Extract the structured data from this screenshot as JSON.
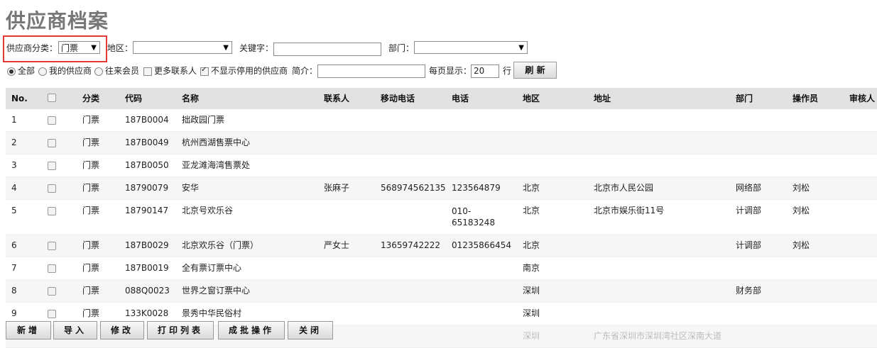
{
  "page": {
    "title": "供应商档案"
  },
  "filters": {
    "category_label": "供应商分类：",
    "category_value": "门票",
    "region_label": "地区：",
    "region_value": "",
    "keyword_label": "关键字：",
    "keyword_value": "",
    "dept_label": "部门：",
    "dept_value": ""
  },
  "options": {
    "all": "全部",
    "mine": "我的供应商",
    "past": "往来会员",
    "more_contacts": "更多联系人",
    "hide_disabled": "不显示停用的供应商",
    "intro_label": "简介：",
    "intro_value": "",
    "per_page_label": "每页显示：",
    "per_page_value": "20",
    "row_unit": "行",
    "refresh": "刷 新"
  },
  "table": {
    "headers": {
      "no": "No.",
      "category": "分类",
      "code": "代码",
      "name": "名称",
      "contact": "联系人",
      "mobile": "移动电话",
      "phone": "电话",
      "region": "地区",
      "address": "地址",
      "dept": "部门",
      "operator": "操作员",
      "reviewer": "审核人"
    },
    "rows": [
      {
        "no": "1",
        "category": "门票",
        "code": "187B0004",
        "name": "拙政园门票",
        "contact": "",
        "mobile": "",
        "phone": "",
        "region": "",
        "address": "",
        "dept": "",
        "operator": ""
      },
      {
        "no": "2",
        "category": "门票",
        "code": "187B0049",
        "name": "杭州西湖售票中心",
        "contact": "",
        "mobile": "",
        "phone": "",
        "region": "",
        "address": "",
        "dept": "",
        "operator": ""
      },
      {
        "no": "3",
        "category": "门票",
        "code": "187B0050",
        "name": "亚龙滩海湾售票处",
        "contact": "",
        "mobile": "",
        "phone": "",
        "region": "",
        "address": "",
        "dept": "",
        "operator": ""
      },
      {
        "no": "4",
        "category": "门票",
        "code": "18790079",
        "name": "安华",
        "contact": "张麻子",
        "mobile": "568974562135",
        "phone": "123564879",
        "region": "北京",
        "address": "北京市人民公园",
        "dept": "网络部",
        "operator": "刘松"
      },
      {
        "no": "5",
        "category": "门票",
        "code": "18790147",
        "name": "北京号欢乐谷",
        "contact": "",
        "mobile": "",
        "phone": "010-65183248",
        "region": "北京",
        "address": "北京市娱乐街11号",
        "dept": "计调部",
        "operator": "刘松"
      },
      {
        "no": "6",
        "category": "门票",
        "code": "187B0029",
        "name": "北京欢乐谷（门票）",
        "contact": "严女士",
        "mobile": "13659742222",
        "phone": "01235866454",
        "region": "北京",
        "address": "",
        "dept": "计调部",
        "operator": "刘松"
      },
      {
        "no": "7",
        "category": "门票",
        "code": "187B0019",
        "name": "全有票订票中心",
        "contact": "",
        "mobile": "",
        "phone": "",
        "region": "南京",
        "address": "",
        "dept": "",
        "operator": ""
      },
      {
        "no": "8",
        "category": "门票",
        "code": "088Q0023",
        "name": "世界之窗订票中心",
        "contact": "",
        "mobile": "",
        "phone": "",
        "region": "深圳",
        "address": "",
        "dept": "财务部",
        "operator": ""
      },
      {
        "no": "9",
        "category": "门票",
        "code": "133K0028",
        "name": "景秀中华民俗村",
        "contact": "",
        "mobile": "",
        "phone": "",
        "region": "深圳",
        "address": "",
        "dept": "",
        "operator": ""
      }
    ],
    "partial_row": {
      "region": "深圳",
      "address": "广东省深圳市深圳湾社区深南大道"
    }
  },
  "actions": {
    "add": "新增",
    "import": "导入",
    "edit": "修改",
    "print": "打印列表",
    "batch": "成批操作",
    "close": "关闭"
  }
}
